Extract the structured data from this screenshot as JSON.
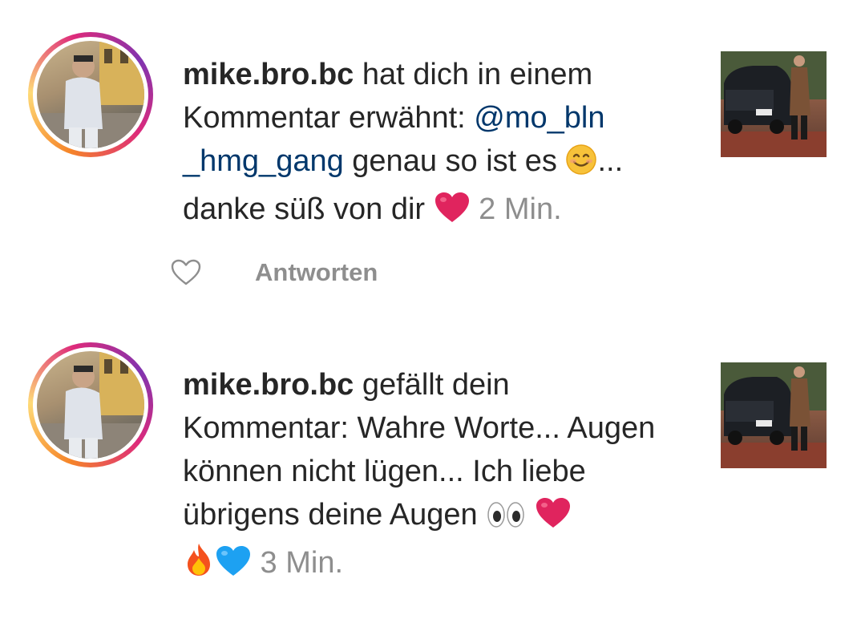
{
  "notifications": [
    {
      "username": "mike.bro.bc",
      "action_text": " hat dich in einem Kommentar erwähnt: ",
      "mention": "@mo_bln _hmg_gang",
      "comment_text": " genau so ist es ",
      "comment_tail": "... danke süß von dir ",
      "time": " 2 Min.",
      "reply_label": "Antworten",
      "emojis": [
        "smiling-face-icon",
        "red-heart-icon"
      ]
    },
    {
      "username": "mike.bro.bc",
      "action_text": " gefällt dein Kommentar: Wahre Worte... Augen können nicht lügen... Ich liebe übrigens deine Augen ",
      "time": " 3 Min.",
      "emojis": [
        "eyes-icon",
        "red-heart-icon",
        "fire-icon",
        "blue-heart-icon"
      ]
    }
  ],
  "colors": {
    "username": "#262626",
    "mention": "#00376b",
    "time": "#8e8e8e",
    "reply": "#8e8e8e",
    "heart_red": "#e0245e",
    "heart_blue": "#1da1f2"
  }
}
